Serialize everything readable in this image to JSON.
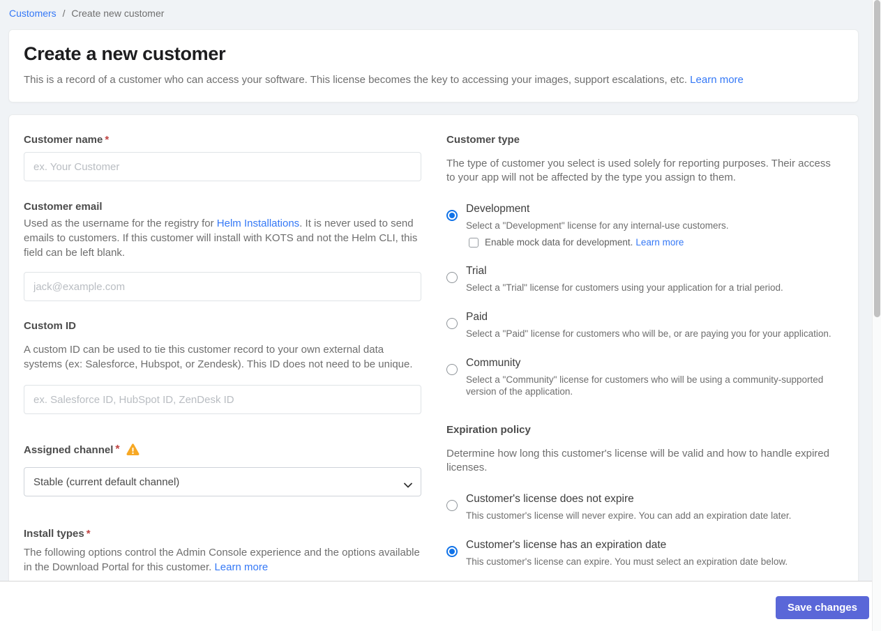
{
  "breadcrumb": {
    "customers_link": "Customers",
    "separator": "/",
    "current": "Create new customer"
  },
  "header": {
    "title": "Create a new customer",
    "description": "This is a record of a customer who can access your software. This license becomes the key to accessing your images, support escalations, etc.",
    "learn_more": "Learn more"
  },
  "form_left": {
    "customer_name": {
      "label": "Customer name",
      "required": "*",
      "placeholder": "ex. Your Customer"
    },
    "customer_email": {
      "label": "Customer email",
      "desc_before_link": "Used as the username for the registry for ",
      "desc_link": "Helm Installations",
      "desc_after_link": ". It is never used to send emails to customers. If this customer will install with KOTS and not the Helm CLI, this field can be left blank.",
      "placeholder": "jack@example.com"
    },
    "custom_id": {
      "label": "Custom ID",
      "description": "A custom ID can be used to tie this customer record to your own external data systems (ex: Salesforce, Hubspot, or Zendesk). This ID does not need to be unique.",
      "placeholder": "ex. Salesforce ID, HubSpot ID, ZenDesk ID"
    },
    "assigned_channel": {
      "label": "Assigned channel",
      "required": "*",
      "selected_option": "Stable (current default channel)"
    },
    "install_types": {
      "label": "Install types",
      "required": "*",
      "description": "The following options control the Admin Console experience and the options available in the Download Portal for this customer.",
      "learn_more": "Learn more"
    }
  },
  "customer_type": {
    "heading": "Customer type",
    "description": "The type of customer you select is used solely for reporting purposes. Their access to your app will not be affected by the type you assign to them.",
    "options": [
      {
        "title": "Development",
        "description": "Select a \"Development\" license for any internal-use customers.",
        "selected": true,
        "checkbox_label": "Enable mock data for development.",
        "checkbox_link": "Learn more",
        "checkbox_checked": false
      },
      {
        "title": "Trial",
        "description": "Select a \"Trial\" license for customers using your application for a trial period.",
        "selected": false
      },
      {
        "title": "Paid",
        "description": "Select a \"Paid\" license for customers who will be, or are paying you for your application.",
        "selected": false
      },
      {
        "title": "Community",
        "description": "Select a \"Community\" license for customers who will be using a community-supported version of the application.",
        "selected": false
      }
    ]
  },
  "expiration_policy": {
    "heading": "Expiration policy",
    "description": "Determine how long this customer's license will be valid and how to handle expired licenses.",
    "options": [
      {
        "title": "Customer's license does not expire",
        "description": "This customer's license will never expire. You can add an expiration date later.",
        "selected": false
      },
      {
        "title": "Customer's license has an expiration date",
        "description": "This customer's license can expire. You must select an expiration date below.",
        "selected": true
      }
    ]
  },
  "footer": {
    "save_label": "Save changes"
  },
  "colors": {
    "page_background": "#f0f3f6",
    "link_blue": "#3478f6",
    "radio_blue": "#1173e8",
    "required_red": "#bf4342",
    "warning_amber": "#f7a824",
    "save_button": "#5a67d8"
  }
}
